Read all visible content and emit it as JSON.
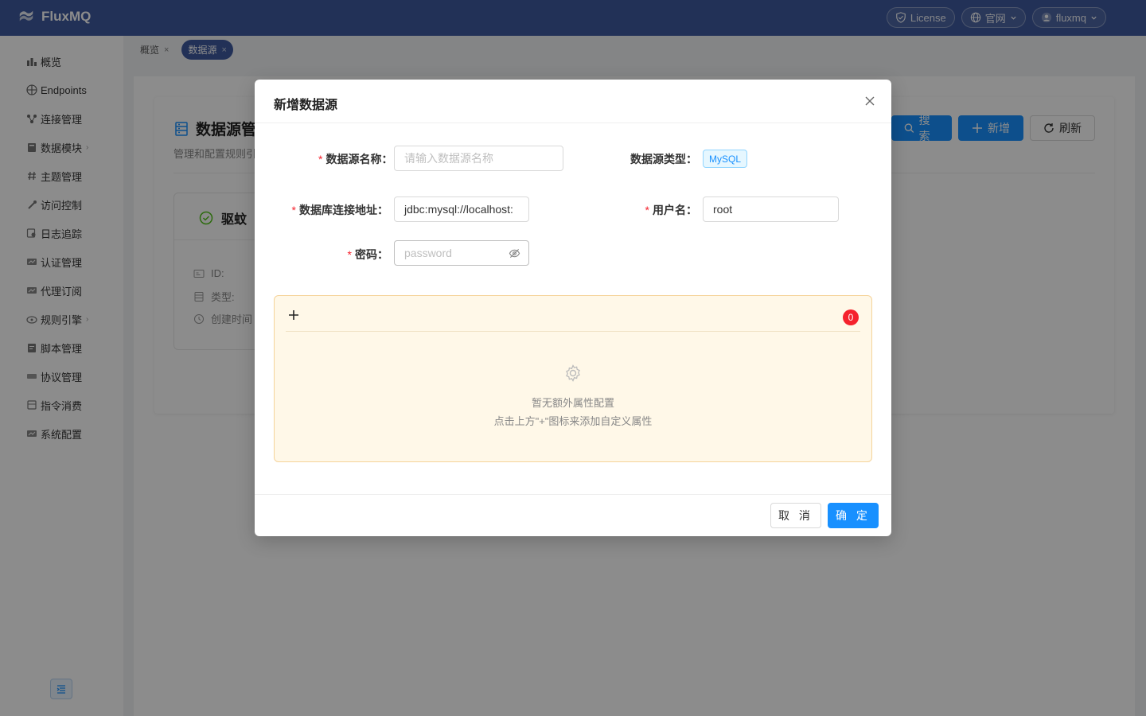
{
  "app": {
    "name": "FluxMQ"
  },
  "header": {
    "license_label": "License",
    "site_label": "官网",
    "user_label": "fluxmq"
  },
  "sidebar": {
    "items": [
      {
        "label": "概览",
        "icon": "dashboard-icon",
        "has_children": false
      },
      {
        "label": "Endpoints",
        "icon": "globe-icon",
        "has_children": false
      },
      {
        "label": "连接管理",
        "icon": "connection-icon",
        "has_children": false
      },
      {
        "label": "数据模块",
        "icon": "database-icon",
        "has_children": true
      },
      {
        "label": "主题管理",
        "icon": "hash-icon",
        "has_children": false
      },
      {
        "label": "访问控制",
        "icon": "lock-icon",
        "has_children": false
      },
      {
        "label": "日志追踪",
        "icon": "log-icon",
        "has_children": false
      },
      {
        "label": "认证管理",
        "icon": "auth-icon",
        "has_children": false
      },
      {
        "label": "代理订阅",
        "icon": "proxy-icon",
        "has_children": false
      },
      {
        "label": "规则引擎",
        "icon": "rule-icon",
        "has_children": true
      },
      {
        "label": "脚本管理",
        "icon": "script-icon",
        "has_children": false
      },
      {
        "label": "协议管理",
        "icon": "protocol-icon",
        "has_children": false
      },
      {
        "label": "指令消费",
        "icon": "command-icon",
        "has_children": false
      },
      {
        "label": "系统配置",
        "icon": "settings-icon",
        "has_children": false
      }
    ]
  },
  "tabs": [
    {
      "label": "概览",
      "close": "×",
      "active": false
    },
    {
      "label": "数据源",
      "close": "×",
      "active": true
    }
  ],
  "page": {
    "title": "数据源管",
    "subtitle": "管理和配置规则引",
    "search_label": "搜索",
    "add_label": "新增",
    "refresh_label": "刷新",
    "driver_title": "驱蚊",
    "meta": [
      {
        "label": "ID:",
        "icon": "id-icon"
      },
      {
        "label": "类型:",
        "icon": "list-icon"
      },
      {
        "label": "创建时间",
        "icon": "clock-icon"
      }
    ]
  },
  "modal": {
    "title": "新增数据源",
    "name_label": "数据源名称",
    "name_placeholder": "请输入数据源名称",
    "type_label": "数据源类型",
    "type_value": "MySQL",
    "url_label": "数据库连接地址",
    "url_value": "jdbc:mysql://localhost:",
    "username_label": "用户名",
    "username_value": "root",
    "password_label": "密码",
    "password_placeholder": "password",
    "required_mark": "*",
    "label_colon": "：",
    "props_count": "0",
    "props_empty_title": "暂无额外属性配置",
    "props_empty_hint": "点击上方\"+\"图标来添加自定义属性",
    "cancel_label": "取 消",
    "ok_label": "确 定"
  },
  "colors": {
    "header_bg": "#3e5a9e",
    "primary": "#1890ff",
    "required": "#f5222d",
    "props_bg": "#fff8e8"
  }
}
